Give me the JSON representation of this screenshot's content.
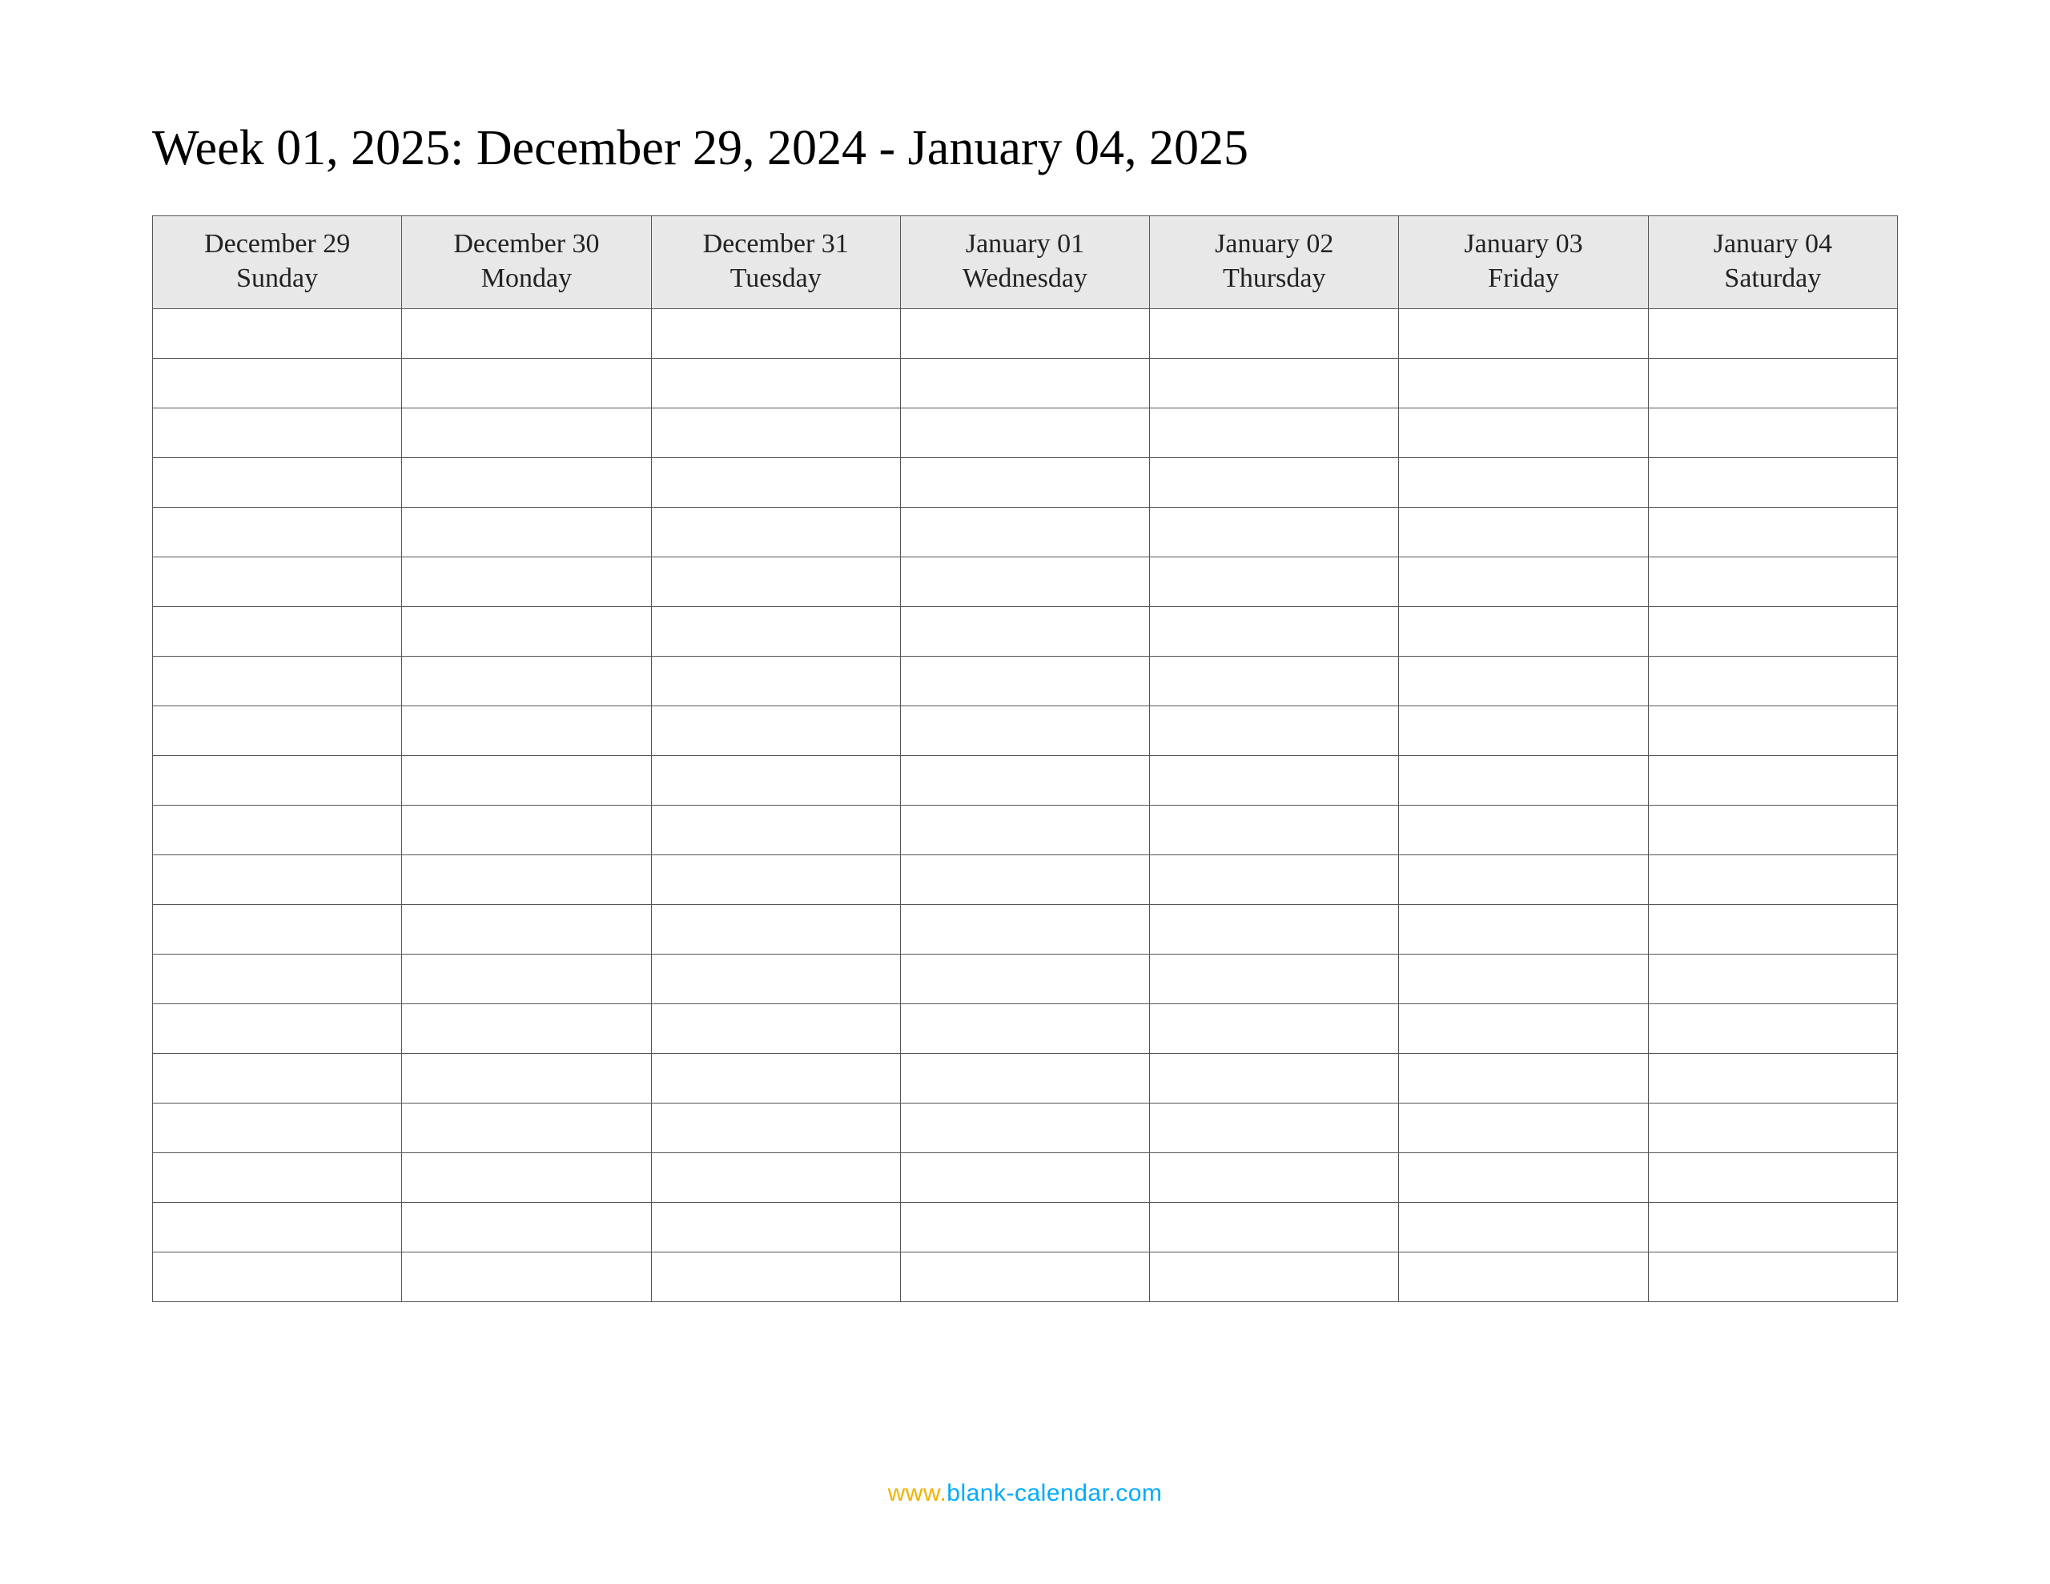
{
  "title": "Week 01, 2025: December 29, 2024 - January 04, 2025",
  "columns": [
    {
      "date": "December 29",
      "dow": "Sunday"
    },
    {
      "date": "December 30",
      "dow": "Monday"
    },
    {
      "date": "December 31",
      "dow": "Tuesday"
    },
    {
      "date": "January 01",
      "dow": "Wednesday"
    },
    {
      "date": "January 02",
      "dow": "Thursday"
    },
    {
      "date": "January 03",
      "dow": "Friday"
    },
    {
      "date": "January 04",
      "dow": "Saturday"
    }
  ],
  "row_count": 20,
  "footer": {
    "prefix": "www.",
    "domain": "blank-calendar.com"
  }
}
